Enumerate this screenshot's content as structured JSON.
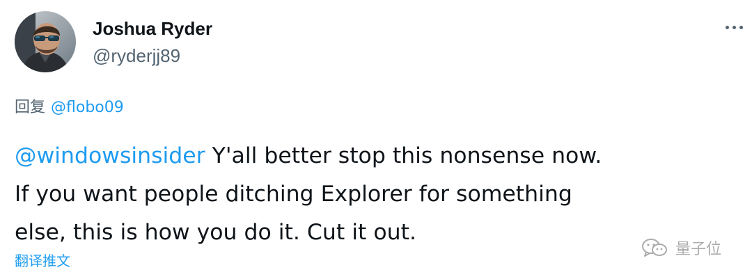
{
  "tweet": {
    "author": {
      "display_name": "Joshua Ryder",
      "handle": "@ryderjj89"
    },
    "more_icon": "more-horizontal-icon",
    "reply": {
      "prefix": "回复",
      "mention": "@flobo09"
    },
    "text": {
      "mention": "@windowsinsider",
      "line1_rest": " Y'all better stop this nonsense now.",
      "line2": "If you want people ditching Explorer for something",
      "line3": "else, this is how you do it. Cut it out."
    },
    "translate_label": "翻译推文"
  },
  "watermark": {
    "icon": "wechat-icon",
    "text": "量子位"
  },
  "colors": {
    "link": "#1d9bf0",
    "secondary_text": "#536471",
    "primary_text": "#0f1419"
  }
}
